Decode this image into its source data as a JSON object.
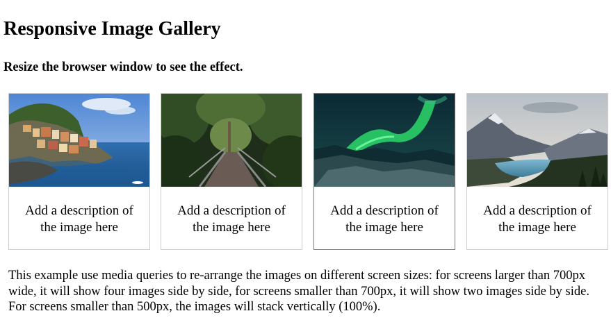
{
  "page": {
    "title": "Responsive Image Gallery",
    "subtitle": "Resize the browser window to see the effect."
  },
  "gallery": {
    "items": [
      {
        "image": "cinque-terre-image",
        "description": "Add a description of the image here"
      },
      {
        "image": "forest-bridge-image",
        "description": "Add a description of the image here"
      },
      {
        "image": "northern-lights-image",
        "description": "Add a description of the image here"
      },
      {
        "image": "mountains-lake-image",
        "description": "Add a description of the image here"
      }
    ]
  },
  "footer": {
    "text": "This example use media queries to re-arrange the images on different screen sizes: for screens larger than 700px wide, it will show four images side by side, for screens smaller than 700px, it will show two images side by side. For screens smaller than 500px, the images will stack vertically (100%)."
  },
  "colors": {
    "border": "#cccccc",
    "hover_border": "#777777"
  }
}
